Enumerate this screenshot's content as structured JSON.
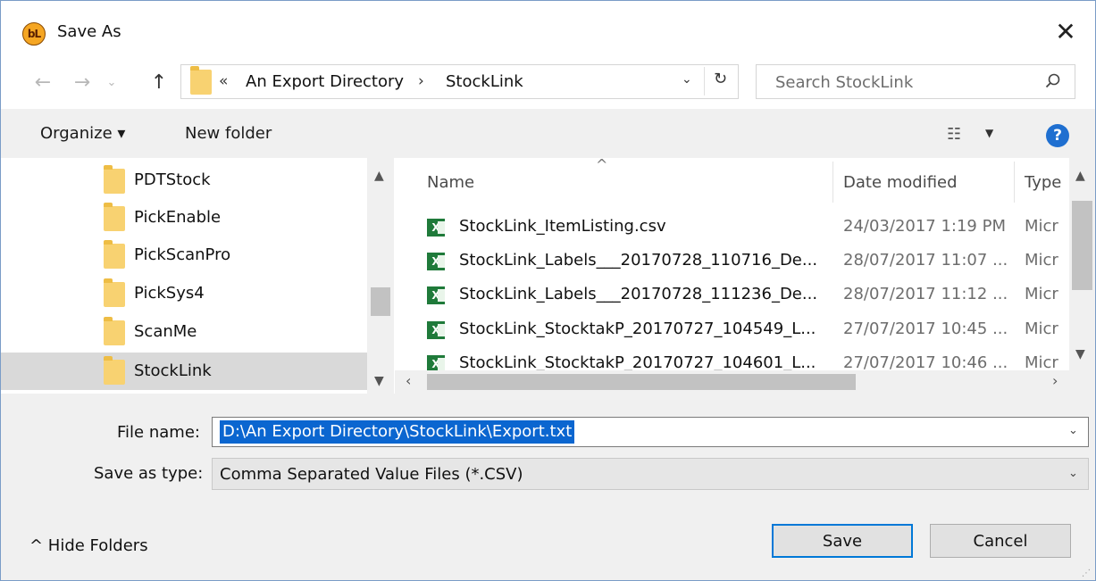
{
  "dialog": {
    "app_icon_text": "bL",
    "title": "Save As",
    "close_glyph": "✕"
  },
  "nav": {
    "back_glyph": "←",
    "forward_glyph": "→",
    "recent_glyph": "⌄",
    "up_glyph": "↑"
  },
  "address": {
    "overflow": "«",
    "crumbs": [
      "An Export Directory",
      "StockLink"
    ],
    "separator": "›",
    "dropdown_glyph": "⌄",
    "refresh_glyph": "↻"
  },
  "search": {
    "placeholder": "Search StockLink"
  },
  "toolbar": {
    "organize_label": "Organize ▾",
    "new_folder_label": "New folder",
    "view_glyph": "☷",
    "view_dropdown_glyph": "▼",
    "help_glyph": "?"
  },
  "navpane": {
    "items": [
      {
        "label": "PDTStock",
        "selected": false
      },
      {
        "label": "PickEnable",
        "selected": false
      },
      {
        "label": "PickScanPro",
        "selected": false
      },
      {
        "label": "PickSys4",
        "selected": false
      },
      {
        "label": "ScanMe",
        "selected": false
      },
      {
        "label": "StockLink",
        "selected": true
      }
    ]
  },
  "filelist": {
    "columns": {
      "name": "Name",
      "date": "Date modified",
      "type": "Type"
    },
    "sort_caret": "^",
    "files": [
      {
        "name": "StockLink_ItemListing.csv",
        "date": "24/03/2017 1:19 PM",
        "type": "Micr"
      },
      {
        "name": "StockLink_Labels___20170728_110716_De...",
        "date": "28/07/2017 11:07 ...",
        "type": "Micr"
      },
      {
        "name": "StockLink_Labels___20170728_111236_De...",
        "date": "28/07/2017 11:12 ...",
        "type": "Micr"
      },
      {
        "name": "StockLink_StocktakP_20170727_104549_L...",
        "date": "27/07/2017 10:45 ...",
        "type": "Micr"
      },
      {
        "name": "StockLink_StocktakP_20170727_104601_L...",
        "date": "27/07/2017 10:46 ...",
        "type": "Micr"
      }
    ],
    "excel_icon_text": "X"
  },
  "form": {
    "file_name_label": "File name:",
    "file_name_value": "D:\\An Export Directory\\StockLink\\Export.txt",
    "save_as_type_label": "Save as type:",
    "save_as_type_value": "Comma Separated Value Files (*.CSV)",
    "dropdown_glyph": "⌄"
  },
  "footer": {
    "hide_folders_label": "^  Hide Folders",
    "save_label": "Save",
    "cancel_label": "Cancel",
    "grip_glyph": "⋰"
  },
  "colors": {
    "selection": "#0b66d0",
    "help": "#1f6fd0",
    "folder": "#f8d271",
    "excel": "#1f7a3a",
    "default_button_border": "#0078d7"
  }
}
